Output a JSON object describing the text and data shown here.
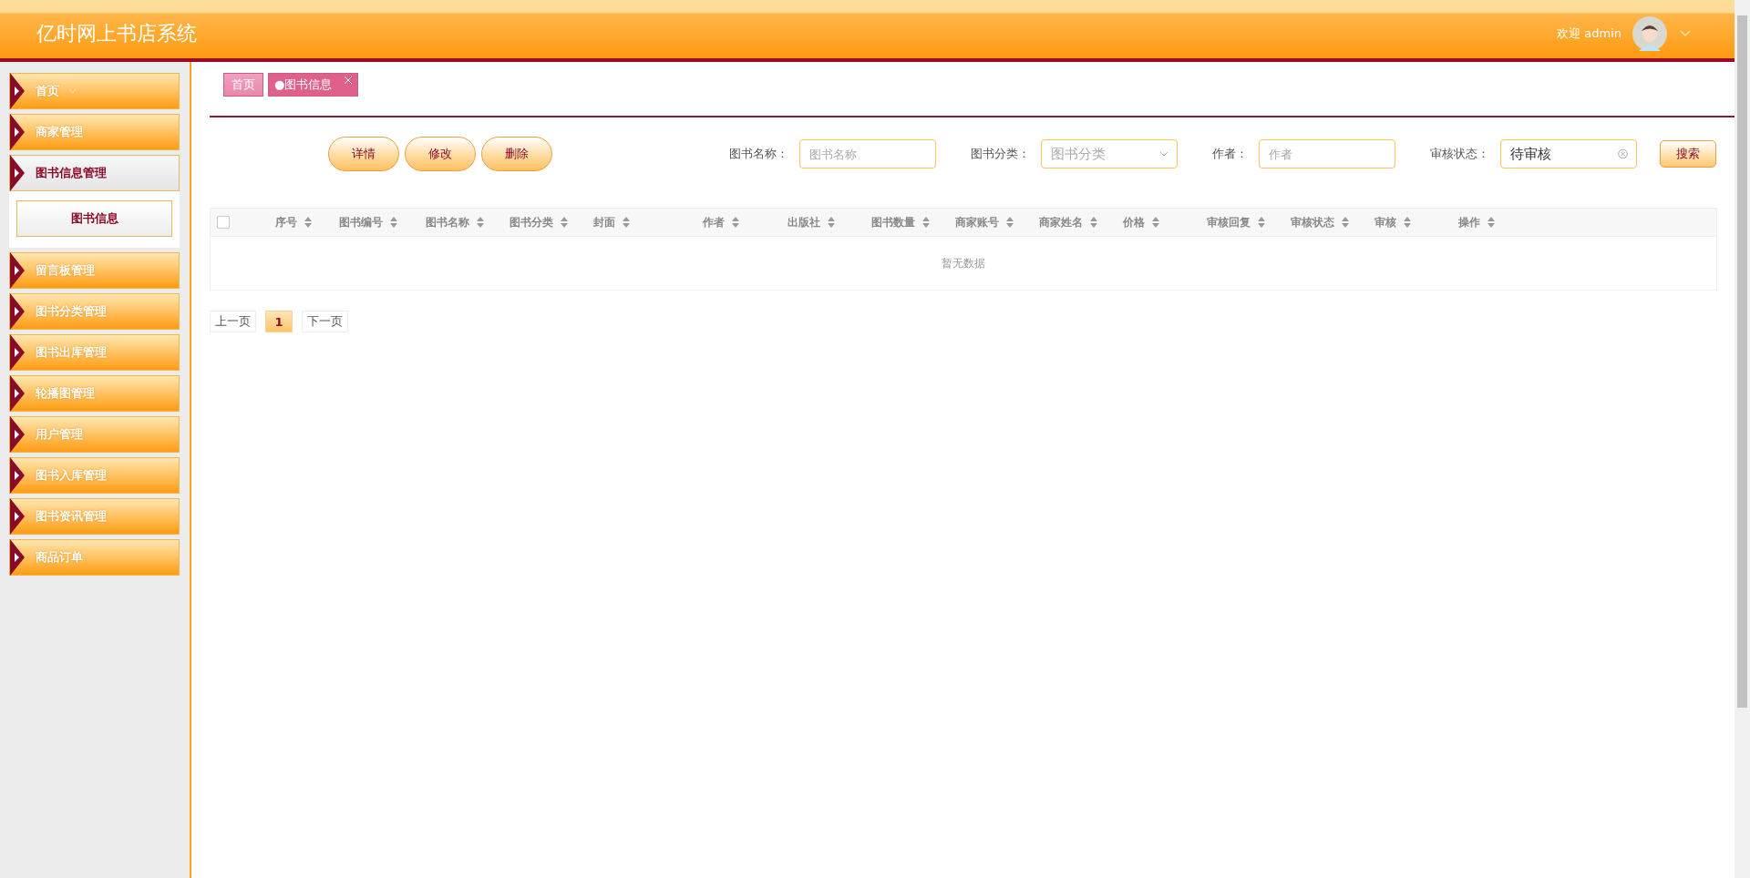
{
  "header": {
    "title": "亿时网上书店系统",
    "welcome": "欢迎 admin"
  },
  "sidebar": {
    "items": [
      {
        "label": "首页",
        "selected": false,
        "dropdown": true
      },
      {
        "label": "商家管理",
        "selected": false
      },
      {
        "label": "图书信息管理",
        "selected": true,
        "expanded": true,
        "children": [
          {
            "label": "图书信息",
            "selected": true
          }
        ]
      },
      {
        "label": "留言板管理",
        "selected": false
      },
      {
        "label": "图书分类管理",
        "selected": false
      },
      {
        "label": "图书出库管理",
        "selected": false
      },
      {
        "label": "轮播图管理",
        "selected": false
      },
      {
        "label": "用户管理",
        "selected": false
      },
      {
        "label": "图书入库管理",
        "selected": false
      },
      {
        "label": "图书资讯管理",
        "selected": false
      },
      {
        "label": "商品订单",
        "selected": false
      }
    ]
  },
  "tabs": [
    {
      "label": "首页",
      "selected": false,
      "closable": false
    },
    {
      "label": "●图书信息",
      "selected": true,
      "closable": true
    }
  ],
  "actions": [
    "详情",
    "修改",
    "删除"
  ],
  "filters": [
    {
      "kind": "text",
      "label": "图书名称：",
      "placeholder": "图书名称"
    },
    {
      "kind": "select",
      "label": "图书分类：",
      "placeholder": "图书分类"
    },
    {
      "kind": "text",
      "label": "作者：",
      "placeholder": "作者"
    },
    {
      "kind": "text",
      "label": "审核状态：",
      "value": "待审核",
      "clearable": true
    }
  ],
  "search_button": "搜索",
  "table": {
    "select_all": {
      "checked": false
    },
    "columns": [
      "序号",
      "图书编号",
      "图书名称",
      "图书分类",
      "封面",
      "作者",
      "出版社",
      "图书数量",
      "商家账号",
      "商家姓名",
      "价格",
      "审核回复",
      "审核状态",
      "审核",
      "操作"
    ],
    "empty_text": "暂无数据"
  },
  "pagination": {
    "prev": "上一页",
    "pages": [
      {
        "label": "1",
        "selected": true
      }
    ],
    "next": "下一页"
  }
}
